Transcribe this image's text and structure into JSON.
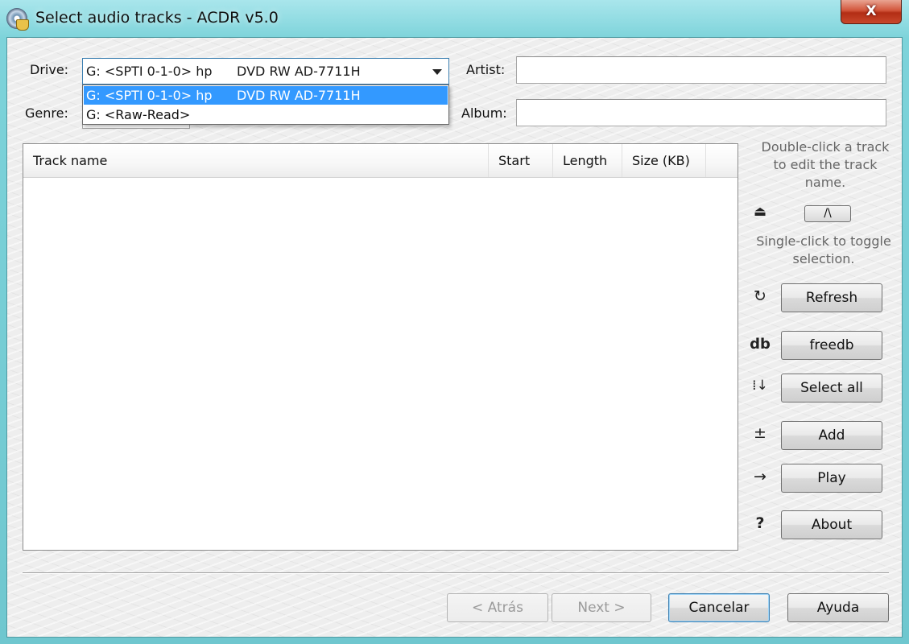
{
  "window": {
    "title": "Select audio tracks - ACDR v5.0",
    "close_glyph": "X"
  },
  "form": {
    "drive_label": "Drive:",
    "drive_selected": "G: <SPTI 0-1-0> hp      DVD RW AD-7711H",
    "drive_options": [
      "G: <SPTI 0-1-0> hp      DVD RW AD-7711H",
      "G: <Raw-Read>"
    ],
    "genre_label": "Genre:",
    "genre_value": "",
    "artist_label": "Artist:",
    "artist_value": "",
    "album_label": "Album:",
    "album_value": ""
  },
  "track_list": {
    "columns": [
      "Track name",
      "Start",
      "Length",
      "Size (KB)"
    ],
    "rows": []
  },
  "side_panel": {
    "hint_edit": "Double-click a track to edit the track name.",
    "eject_icon": "⏏",
    "up_button": "/\\",
    "hint_select": "Single-click to toggle selection.",
    "buttons": [
      {
        "label": "Refresh",
        "icon": "↻"
      },
      {
        "label": "freedb",
        "icon": "db"
      },
      {
        "label": "Select all",
        "icon": "⁞↓"
      },
      {
        "label": "Add",
        "icon": "±"
      },
      {
        "label": "Play",
        "icon": "→"
      },
      {
        "label": "About",
        "icon": "?"
      }
    ]
  },
  "footer": {
    "back_label": "< Atrás",
    "next_label": "Next >",
    "cancel_label": "Cancelar",
    "help_label": "Ayuda"
  }
}
